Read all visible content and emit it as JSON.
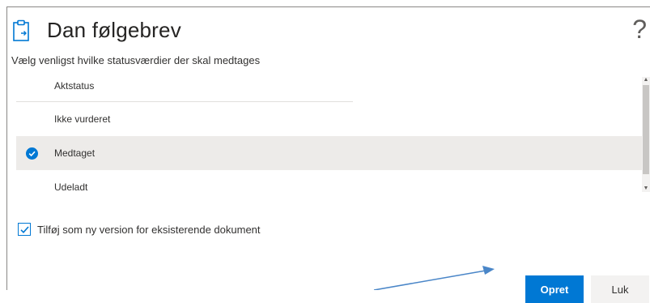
{
  "dialog": {
    "title": "Dan følgebrev",
    "help_icon": "question-mark-icon",
    "help_glyph": "?",
    "subtitle": "Vælg venligst hvilke statusværdier der skal medtages"
  },
  "list": {
    "header": "Aktstatus",
    "items": [
      {
        "label": "Ikke vurderet",
        "selected": false
      },
      {
        "label": "Medtaget",
        "selected": true
      },
      {
        "label": "Udeladt",
        "selected": false
      }
    ]
  },
  "option": {
    "label": "Tilføj som ny version for eksisterende dokument",
    "checked": true
  },
  "buttons": {
    "create": "Opret",
    "close": "Luk"
  },
  "colors": {
    "accent": "#0078d4",
    "selected_row": "#edebe9",
    "annotation_arrow": "#4a86c8"
  }
}
